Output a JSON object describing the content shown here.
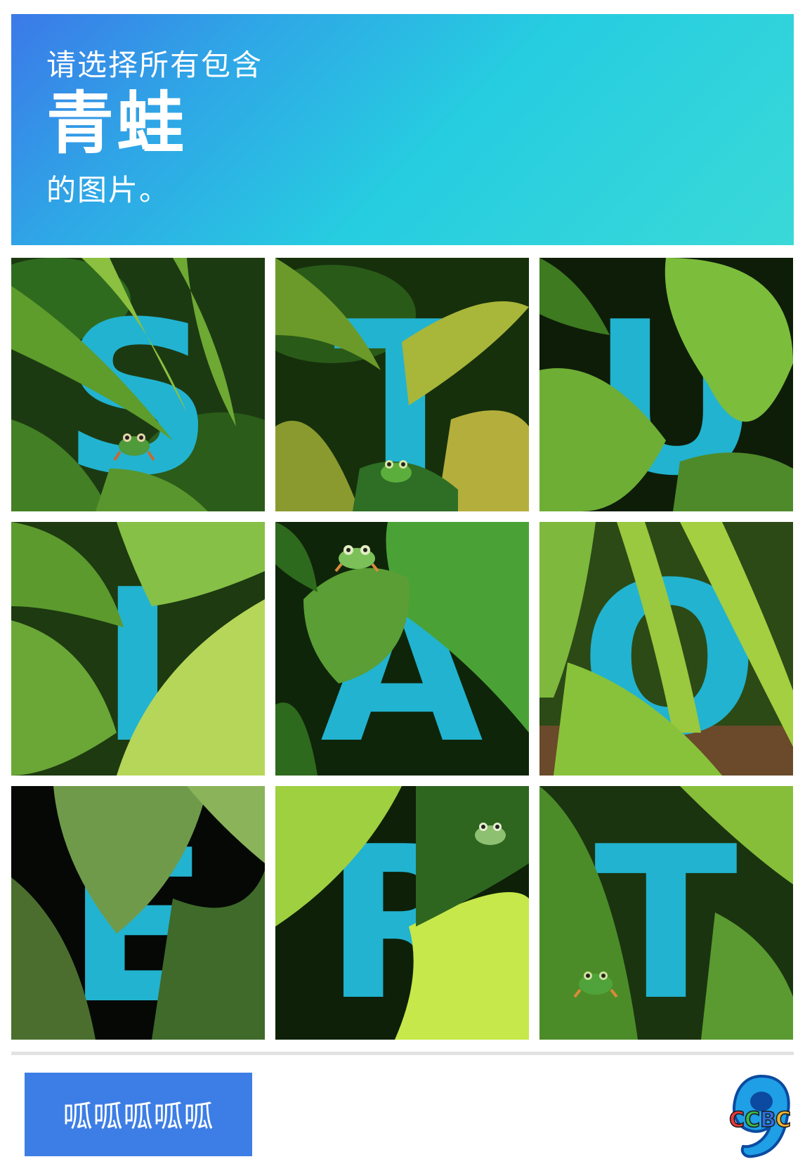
{
  "header": {
    "line1": "请选择所有包含",
    "keyword": "青蛙",
    "line3": "的图片。"
  },
  "tiles": [
    {
      "letter": "S",
      "has_frog": true
    },
    {
      "letter": "T",
      "has_frog": true
    },
    {
      "letter": "U",
      "has_frog": false
    },
    {
      "letter": "I",
      "has_frog": false
    },
    {
      "letter": "A",
      "has_frog": true
    },
    {
      "letter": "O",
      "has_frog": false
    },
    {
      "letter": "E",
      "has_frog": false
    },
    {
      "letter": "R",
      "has_frog": true
    },
    {
      "letter": "T",
      "has_frog": true
    }
  ],
  "submit": {
    "label": "呱呱呱呱呱"
  },
  "logo": {
    "text": "CCBC",
    "number": "9"
  },
  "colors": {
    "letter": "#22b3d0",
    "button": "#3d7ee6",
    "header_start": "#3b79e8",
    "header_end": "#3ad9d8"
  }
}
